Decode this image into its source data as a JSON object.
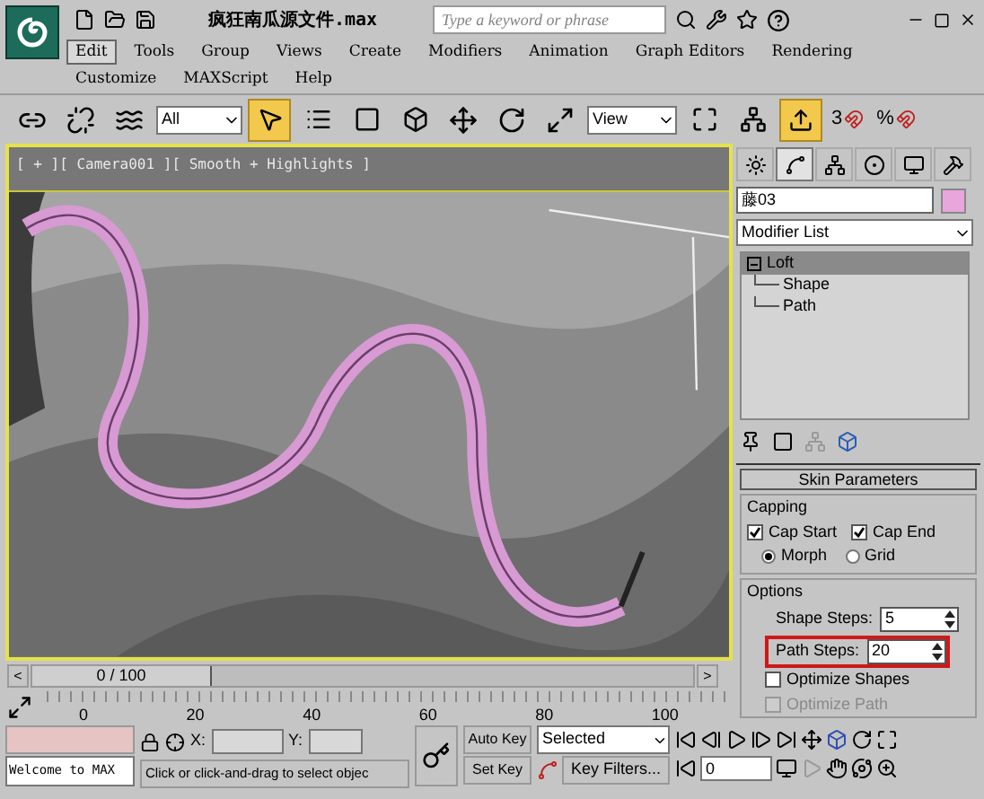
{
  "title_bar": {
    "file_name": "疯狂南瓜源文件.max",
    "search_placeholder": "Type a keyword or phrase"
  },
  "menu": [
    {
      "label": "Edit",
      "selected": true
    },
    {
      "label": "Tools",
      "selected": false
    },
    {
      "label": "Group",
      "selected": false
    },
    {
      "label": "Views",
      "selected": false
    },
    {
      "label": "Create",
      "selected": false
    },
    {
      "label": "Modifiers",
      "selected": false
    },
    {
      "label": "Animation",
      "selected": false
    },
    {
      "label": "Graph Editors",
      "selected": false
    },
    {
      "label": "Rendering",
      "selected": false
    },
    {
      "label": "Customize",
      "selected": false
    },
    {
      "label": "MAXScript",
      "selected": false
    },
    {
      "label": "Help",
      "selected": false
    }
  ],
  "toolbar": {
    "selection_filter": "All",
    "reference_coord": "View",
    "angle_snap_label": "3",
    "percent_snap_label": "%"
  },
  "viewport": {
    "label": "[ + ][ Camera001 ][ Smooth + Highlights ]"
  },
  "command_panel": {
    "tabs": [
      {
        "kind": "create",
        "selected": false
      },
      {
        "kind": "modify",
        "selected": true
      },
      {
        "kind": "hierarchy",
        "selected": false
      },
      {
        "kind": "motion",
        "selected": false
      },
      {
        "kind": "display",
        "selected": false
      },
      {
        "kind": "utilities",
        "selected": false
      }
    ],
    "object_name": "藤03",
    "swatch": {
      "color": "#e8a6dc"
    },
    "modifier_list": "Modifier List",
    "stack": [
      {
        "label": "Loft",
        "selected": true,
        "expanded": true,
        "children": [
          {
            "label": "Shape"
          },
          {
            "label": "Path"
          }
        ]
      }
    ],
    "rollout": {
      "title": "Skin Parameters",
      "capping": {
        "title": "Capping",
        "cap_start": {
          "label": "Cap Start",
          "checked": true
        },
        "cap_end": {
          "label": "Cap End",
          "checked": true
        },
        "types": [
          {
            "label": "Morph",
            "selected": true
          },
          {
            "label": "Grid",
            "selected": false
          }
        ]
      },
      "options": {
        "title": "Options",
        "shape_steps": {
          "label": "Shape Steps:",
          "value": "5",
          "highlighted": false
        },
        "path_steps": {
          "label": "Path Steps:",
          "value": "20",
          "highlighted": true
        },
        "checks": [
          {
            "label": "Optimize Shapes",
            "checked": false,
            "disabled": false
          },
          {
            "label": "Optimize Path",
            "checked": false,
            "disabled": true
          }
        ]
      }
    }
  },
  "time_slider": {
    "prev": "<",
    "position": "0 / 100",
    "next": ">",
    "level": 0
  },
  "track": {
    "ticks": [
      "0",
      "20",
      "40",
      "60",
      "80",
      "100"
    ]
  },
  "status": {
    "listener": "Welcome to MAX",
    "prompt": "Click or click-and-drag to select objec",
    "x_label": "X:",
    "y_label": "Y:",
    "auto_key": "Auto Key",
    "set_key": "Set Key",
    "key_mode": "Selected",
    "key_filters": "Key Filters...",
    "frame": "0"
  }
}
